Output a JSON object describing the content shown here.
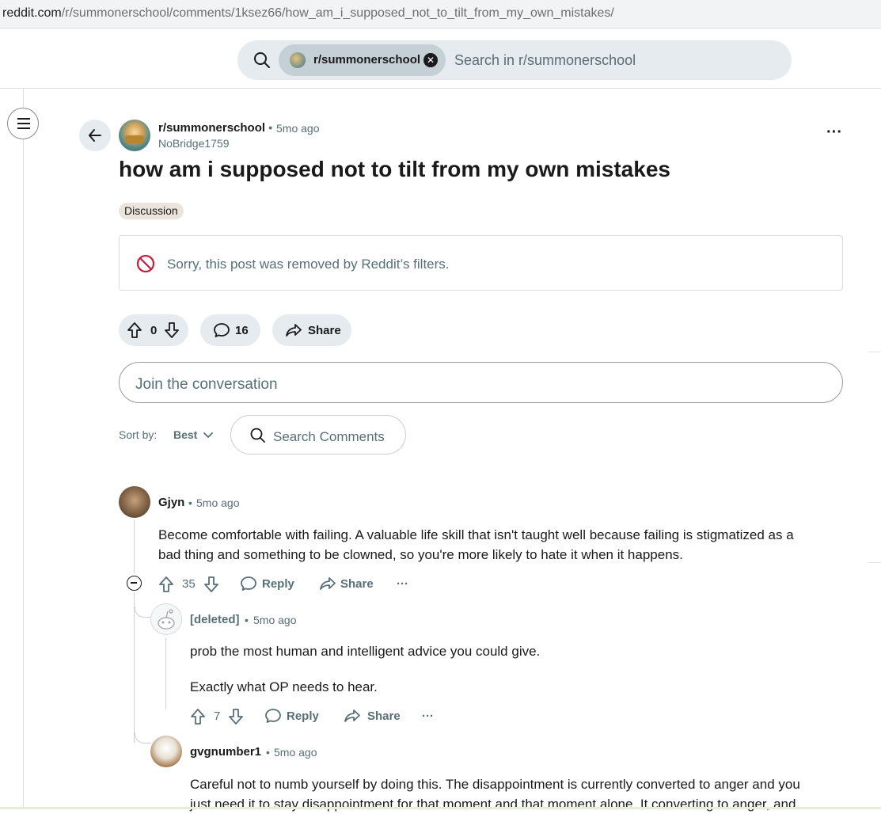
{
  "browser": {
    "url_host": "reddit.com",
    "url_path": "/r/summonerschool/comments/1ksez66/how_am_i_supposed_not_to_tilt_from_my_own_mistakes/"
  },
  "search": {
    "chip_label": "r/summonerschool",
    "placeholder": "Search in r/summonerschool"
  },
  "post": {
    "subreddit": "r/summonerschool",
    "separator": "•",
    "time": "5mo ago",
    "author": "NoBridge1759",
    "title": "how am i supposed not to tilt from my own mistakes",
    "flair": "Discussion",
    "removed_message": "Sorry, this post was removed by Reddit’s filters.",
    "votes": "0",
    "comment_count": "16",
    "share_label": "Share"
  },
  "composer": {
    "placeholder": "Join the conversation"
  },
  "sort": {
    "label": "Sort by:",
    "value": "Best",
    "search_placeholder": "Search Comments"
  },
  "comments": [
    {
      "author": "Gjyn",
      "time": "5mo ago",
      "lines": [
        "Become comfortable with failing. A valuable life skill that isn't taught well because failing is stigmatized as a",
        "bad thing and something to be clowned, so you're more likely to hate it when it happens."
      ],
      "votes": "35",
      "reply": "Reply",
      "share": "Share",
      "more": "···"
    },
    {
      "author": "[deleted]",
      "time": "5mo ago",
      "lines": [
        "prob the most human and intelligent advice you could give.",
        "Exactly what OP needs to hear."
      ],
      "votes": "7",
      "reply": "Reply",
      "share": "Share",
      "more": "···"
    },
    {
      "author": "gvgnumber1",
      "time": "5mo ago",
      "lines": [
        "Careful not to numb yourself by doing this. The disappointment is currently converted to anger and you",
        "just need it to stay disappointment for that moment and that moment alone. It converting to anger, and"
      ]
    }
  ],
  "colors": {
    "search_bg": "#e5ebee",
    "chip_bg": "#c5d0d6",
    "meta_text": "#576f76",
    "error_icon": "#c41e3a"
  }
}
